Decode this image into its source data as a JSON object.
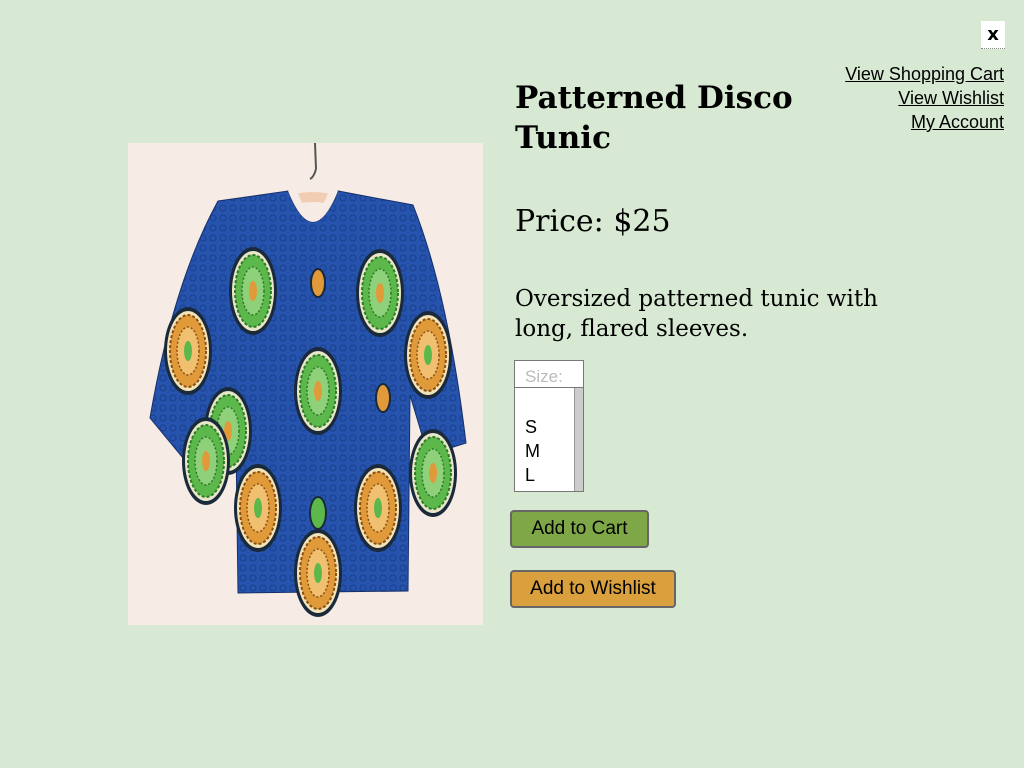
{
  "close_button": {
    "label": "x",
    "icon": "close-icon"
  },
  "account_links": [
    {
      "label": "View Shopping Cart"
    },
    {
      "label": "View Wishlist"
    },
    {
      "label": "My Account"
    }
  ],
  "product": {
    "title": "Patterned Disco Tunic",
    "price_label": "Price: $25",
    "description": "Oversized patterned tunic with long, flared sleeves.",
    "image": "product-photo"
  },
  "size_select": {
    "placeholder": "Size:",
    "options": [
      "S",
      "M",
      "L"
    ]
  },
  "buttons": {
    "add_to_cart": "Add to Cart",
    "add_to_wishlist": "Add to Wishlist"
  },
  "colors": {
    "background": "#d7e9d2",
    "add_to_cart": "#7ea747",
    "add_to_wishlist": "#d9a03d",
    "tunic_blue": "#1f4fa8",
    "motif_green": "#5cb84a",
    "motif_orange": "#e09a3a"
  }
}
